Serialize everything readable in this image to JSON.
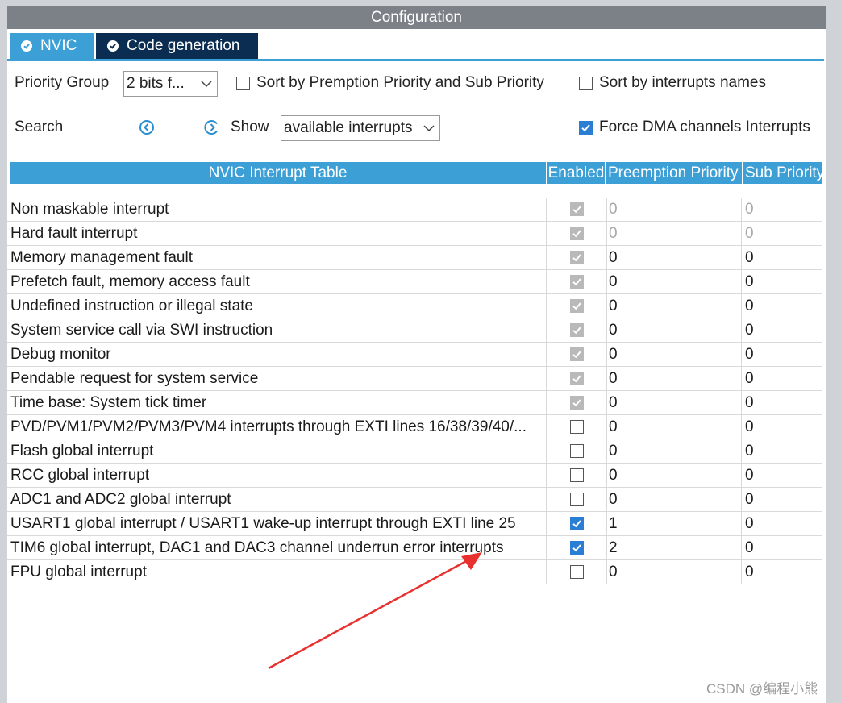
{
  "window": {
    "title": "Configuration"
  },
  "tabs": [
    {
      "label": "NVIC",
      "active": true
    },
    {
      "label": "Code generation",
      "active": false
    }
  ],
  "toolbar": {
    "priority_group_label": "Priority Group",
    "priority_group_value": "2 bits f...",
    "sort_premption_label": "Sort by Premption Priority and Sub Priority",
    "sort_premption_checked": false,
    "sort_names_label": "Sort by interrupts names",
    "sort_names_checked": false,
    "search_label": "Search",
    "show_label": "Show",
    "show_value": "available interrupts",
    "force_dma_label": "Force DMA channels Interrupts",
    "force_dma_checked": true
  },
  "table": {
    "headers": {
      "name": "NVIC Interrupt Table",
      "enabled": "Enabled",
      "preemption": "Preemption Priority",
      "sub": "Sub Priority"
    },
    "rows": [
      {
        "name": "Non maskable interrupt",
        "enabled": "disabled-checked",
        "preemption": "0",
        "sub": "0",
        "muted": true
      },
      {
        "name": "Hard fault interrupt",
        "enabled": "disabled-checked",
        "preemption": "0",
        "sub": "0",
        "muted": true
      },
      {
        "name": "Memory management fault",
        "enabled": "disabled-checked",
        "preemption": "0",
        "sub": "0",
        "muted": false
      },
      {
        "name": "Prefetch fault, memory access fault",
        "enabled": "disabled-checked",
        "preemption": "0",
        "sub": "0",
        "muted": false
      },
      {
        "name": "Undefined instruction or illegal state",
        "enabled": "disabled-checked",
        "preemption": "0",
        "sub": "0",
        "muted": false
      },
      {
        "name": "System service call via SWI instruction",
        "enabled": "disabled-checked",
        "preemption": "0",
        "sub": "0",
        "muted": false
      },
      {
        "name": "Debug monitor",
        "enabled": "disabled-checked",
        "preemption": "0",
        "sub": "0",
        "muted": false
      },
      {
        "name": "Pendable request for system service",
        "enabled": "disabled-checked",
        "preemption": "0",
        "sub": "0",
        "muted": false
      },
      {
        "name": "Time base: System tick timer",
        "enabled": "disabled-checked",
        "preemption": "0",
        "sub": "0",
        "muted": false
      },
      {
        "name": "PVD/PVM1/PVM2/PVM3/PVM4 interrupts through EXTI lines 16/38/39/40/...",
        "enabled": "unchecked",
        "preemption": "0",
        "sub": "0",
        "muted": false
      },
      {
        "name": "Flash global interrupt",
        "enabled": "unchecked",
        "preemption": "0",
        "sub": "0",
        "muted": false
      },
      {
        "name": "RCC global interrupt",
        "enabled": "unchecked",
        "preemption": "0",
        "sub": "0",
        "muted": false
      },
      {
        "name": "ADC1 and ADC2 global interrupt",
        "enabled": "unchecked",
        "preemption": "0",
        "sub": "0",
        "muted": false
      },
      {
        "name": "USART1 global interrupt / USART1 wake-up interrupt through EXTI line 25",
        "enabled": "checked",
        "preemption": "1",
        "sub": "0",
        "muted": false
      },
      {
        "name": "TIM6 global interrupt, DAC1 and DAC3 channel underrun error interrupts",
        "enabled": "checked",
        "preemption": "2",
        "sub": "0",
        "muted": false
      },
      {
        "name": "FPU global interrupt",
        "enabled": "unchecked",
        "preemption": "0",
        "sub": "0",
        "muted": false
      }
    ]
  },
  "icons": {
    "search_prev": "circle-chevron-left-icon",
    "search_next": "circle-chevron-right-icon",
    "tab_check": "check-circle-icon",
    "dropdown": "chevron-down-icon"
  },
  "colors": {
    "accent": "#3c9fd6",
    "tab_dark": "#0b2d52",
    "titlebar": "#7c8087",
    "checkbox_on": "#2a7fd4",
    "checkbox_disabled": "#b9b9b9",
    "annotation_arrow": "#e8312f"
  },
  "watermark": "CSDN @编程小熊"
}
